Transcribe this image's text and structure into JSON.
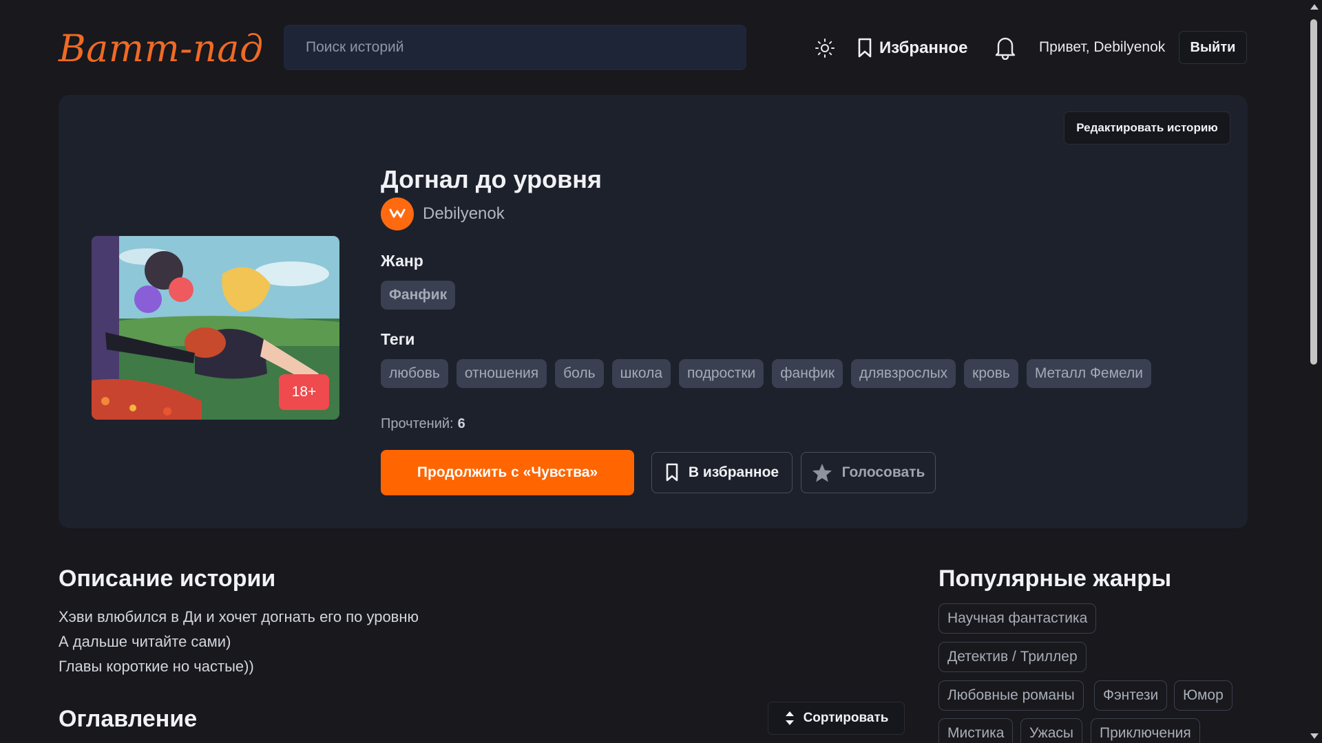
{
  "header": {
    "logo": "Ватт-пад",
    "search_placeholder": "Поиск историй",
    "favorites_label": "Избранное",
    "greeting": "Привет, Debilyenok",
    "logout_label": "Выйти"
  },
  "story": {
    "edit_label": "Редактировать историю",
    "title": "Догнал до уровня",
    "author": "Debilyenok",
    "age_rating": "18+",
    "genre_heading": "Жанр",
    "genre": "Фанфик",
    "tags_heading": "Теги",
    "tags": [
      "любовь",
      "отношения",
      "боль",
      "школа",
      "подростки",
      "фанфик",
      "длявзрослых",
      "кровь",
      "Металл Фемели"
    ],
    "reads_label": "Прочтений:",
    "reads_count": "6",
    "continue_label": "Продолжить с «Чувства»",
    "add_favorite_label": "В избранное",
    "vote_label": "Голосовать"
  },
  "description": {
    "heading": "Описание истории",
    "lines": [
      "Хэви влюбился в Ди и хочет догнать его по уровню",
      "А дальше читайте сами)",
      "Главы короткие но частые))"
    ]
  },
  "toc": {
    "heading": "Оглавление",
    "sort_label": "Сортировать"
  },
  "popular_genres": {
    "heading": "Популярные жанры",
    "items": [
      "Научная фантастика",
      "Детектив / Триллер",
      "Любовные романы",
      "Фэнтези",
      "Юмор",
      "Мистика",
      "Ужасы",
      "Приключения"
    ]
  },
  "colors": {
    "accent": "#ff6500",
    "background": "#18181d",
    "card": "#1d212c",
    "chip": "#3a4052",
    "age_badge": "#ef4a4d"
  },
  "icons": {
    "theme": "sun-icon",
    "favorites": "bookmark-icon",
    "notifications": "bell-icon",
    "vote": "star-icon",
    "sort": "sort-arrows-icon"
  }
}
